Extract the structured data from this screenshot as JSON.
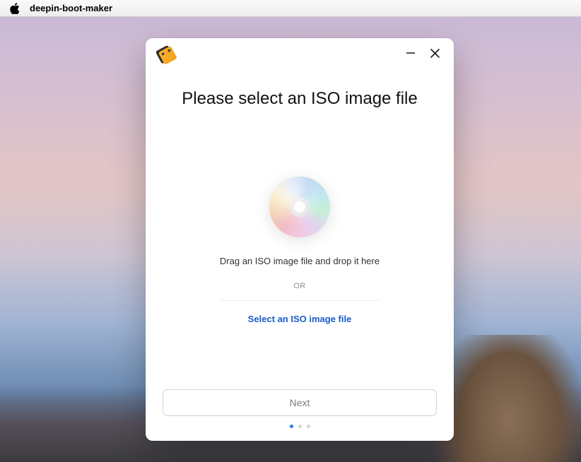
{
  "menubar": {
    "app_name": "deepin-boot-maker"
  },
  "dialog": {
    "heading": "Please select an ISO image file",
    "drop_text": "Drag an ISO image file and drop it here",
    "or_label": "OR",
    "select_link": "Select an ISO image file",
    "next_label": "Next",
    "pager": {
      "total": 3,
      "active_index": 0
    },
    "colors": {
      "link": "#1a5cc8",
      "pager_active": "#1a7cf0"
    }
  }
}
